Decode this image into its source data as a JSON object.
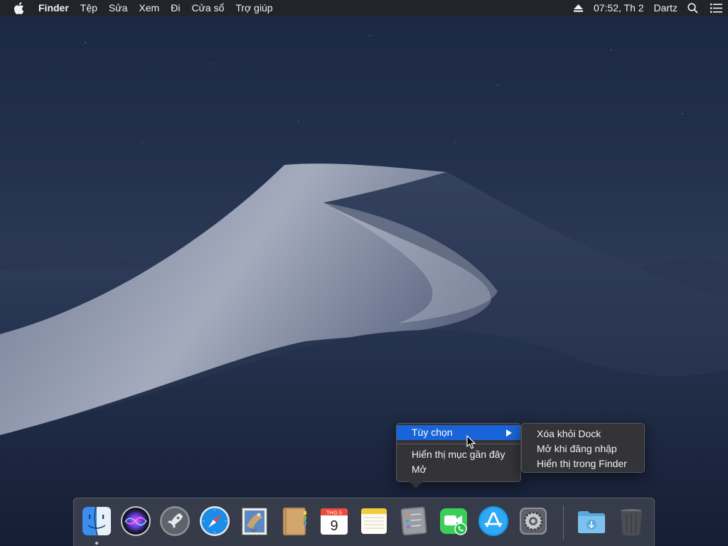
{
  "menubar": {
    "apple_icon": "apple-logo-icon",
    "app_name": "Finder",
    "menus": [
      "Tệp",
      "Sửa",
      "Xem",
      "Đi",
      "Cửa sổ",
      "Trợ giúp"
    ],
    "clock": "07:52, Th 2",
    "user": "Dartz",
    "status_icons": [
      "eject-icon",
      "search-icon",
      "list-icon"
    ]
  },
  "context_menu": {
    "options_label": "Tùy chọn",
    "show_recents_label": "Hiển thị mục gần đây",
    "open_label": "Mở",
    "highlight_color": "#1864d8"
  },
  "submenu": {
    "items": [
      "Xóa khỏi Dock",
      "Mở khi đăng nhập",
      "Hiển thị trong Finder"
    ]
  },
  "dock": {
    "apps": [
      {
        "name": "Finder",
        "icon": "finder-icon",
        "running": true
      },
      {
        "name": "Siri",
        "icon": "siri-icon"
      },
      {
        "name": "Launchpad",
        "icon": "launchpad-icon"
      },
      {
        "name": "Safari",
        "icon": "safari-icon"
      },
      {
        "name": "Mail",
        "icon": "mail-icon"
      },
      {
        "name": "Contacts",
        "icon": "contacts-icon"
      },
      {
        "name": "Calendar",
        "icon": "calendar-icon",
        "month": "THG 5",
        "day": "9"
      },
      {
        "name": "Notes",
        "icon": "notes-icon"
      },
      {
        "name": "Reminders",
        "icon": "reminders-icon"
      },
      {
        "name": "FaceTime",
        "icon": "facetime-icon"
      },
      {
        "name": "App Store",
        "icon": "app-store-icon"
      },
      {
        "name": "System Preferences",
        "icon": "system-preferences-icon"
      },
      {
        "name": "Downloads",
        "icon": "downloads-folder-icon"
      },
      {
        "name": "Trash",
        "icon": "trash-icon"
      }
    ]
  }
}
